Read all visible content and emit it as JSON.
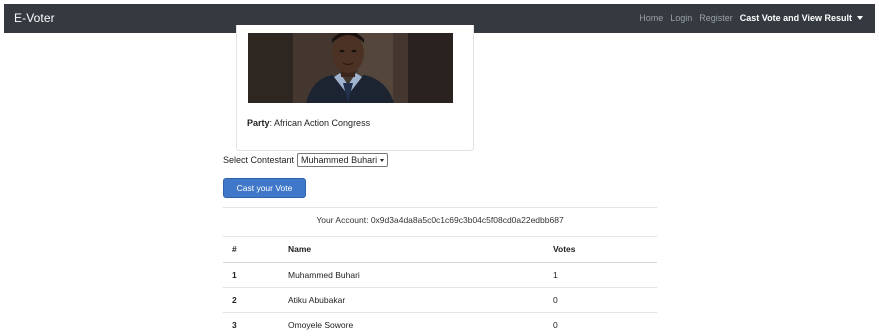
{
  "nav": {
    "brand": "E-Voter",
    "links": [
      "Home",
      "Login",
      "Register"
    ],
    "active_dropdown": "Cast Vote and View Result"
  },
  "candidate_card": {
    "party_label": "Party",
    "party_value": ": African Action Congress"
  },
  "vote_form": {
    "select_label": "Select Contestant",
    "selected_contestant": "Muhammed Buhari",
    "submit_label": "Cast your Vote"
  },
  "account": {
    "text": "Your Account: 0x9d3a4da8a5c0c1c69c3b04c5f08cd0a22edbb687"
  },
  "results": {
    "headers": [
      "#",
      "Name",
      "Votes"
    ],
    "rows": [
      {
        "id": "1",
        "name": "Muhammed Buhari",
        "votes": "1"
      },
      {
        "id": "2",
        "name": "Atiku Abubakar",
        "votes": "0"
      },
      {
        "id": "3",
        "name": "Omoyele Sowore",
        "votes": "0"
      }
    ]
  },
  "colors": {
    "navbar": "#343a40",
    "primary_button": "#3f78c9"
  }
}
